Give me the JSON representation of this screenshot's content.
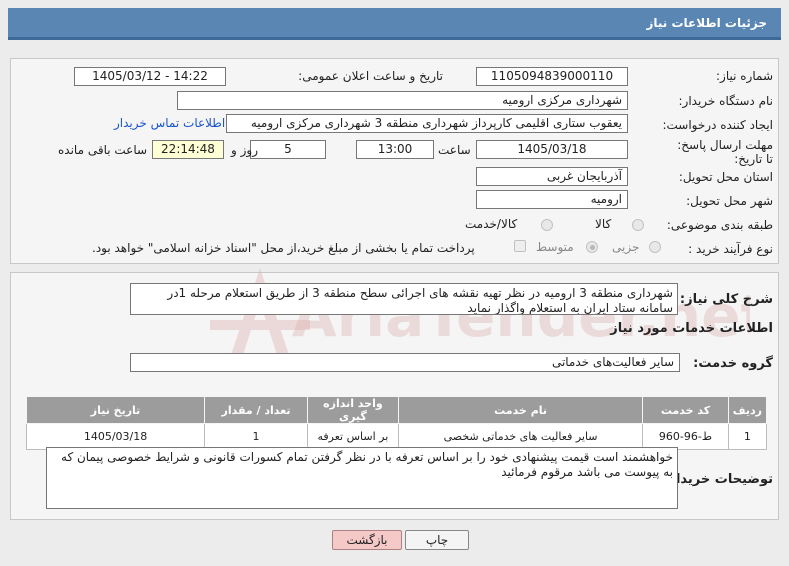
{
  "header": {
    "title": "جزئیات اطلاعات نیاز"
  },
  "form": {
    "need_number_label": "شماره نیاز:",
    "need_number": "1105094839000110",
    "announce_label": "تاریخ و ساعت اعلان عمومی:",
    "announce_value": "1405/03/12 - 14:22",
    "buyer_org_label": "نام دستگاه خریدار:",
    "buyer_org": "شهرداری مرکزی ارومیه",
    "creator_label": "ایجاد کننده درخواست:",
    "creator": "یعقوب ستاری اقلیمی کارپرداز شهرداری منطقه 3 شهرداری مرکزی ارومیه",
    "contact_link": "اطلاعات تماس خریدار",
    "deadline_label": "مهلت ارسال پاسخ: تا تاریخ:",
    "deadline_date": "1405/03/18",
    "time_label": "ساعت",
    "deadline_time": "13:00",
    "days_value": "5",
    "days_label": "روز و",
    "remaining_time": "22:14:48",
    "remaining_label": "ساعت باقی مانده",
    "province_label": "استان محل تحویل:",
    "province": "آذربایجان غربی",
    "city_label": "شهر محل تحویل:",
    "city": "ارومیه",
    "category_label": "طبقه بندی موضوعی:",
    "category_options": [
      "کالا",
      "کالا/خدمت"
    ],
    "process_label": "نوع فرآیند خرید :",
    "process_options": [
      "جزیی",
      "متوسط"
    ],
    "payment_note": "پرداخت تمام یا بخشی از مبلغ خرید،از محل \"اسناد خزانه اسلامی\" خواهد بود."
  },
  "description": {
    "label": "شرح کلی نیاز:",
    "text": "شهرداری منطقه 3 ارومیه در نظر تهیه نقشه های اجرائی سطح منطقه 3 از طریق استعلام مرحله 1در سامانه ستاد ایران به استعلام واگذار نماید"
  },
  "services": {
    "section_title": "اطلاعات خدمات مورد نیاز",
    "group_label": "گروه خدمت:",
    "group_value": "سایر فعالیت‌های خدماتی",
    "columns": [
      "ردیف",
      "کد خدمت",
      "نام خدمت",
      "واحد اندازه گیری",
      "تعداد / مقدار",
      "تاریخ نیاز"
    ],
    "rows": [
      [
        "1",
        "ط-96-960",
        "سایر فعالیت های خدماتی شخصی",
        "بر اساس تعرفه",
        "1",
        "1405/03/18"
      ]
    ]
  },
  "buyer_notes": {
    "label": "توضیحات خریدار:",
    "text": "خواهشمند است قیمت پیشنهادی خود را بر اساس تعرفه با در نظر گرفتن تمام کسورات قانونی و شرایط خصوصی پیمان که به پیوست می باشد مرقوم فرمائید"
  },
  "buttons": {
    "print": "چاپ",
    "back": "بازگشت"
  },
  "watermark": {
    "text": "AriaTender.net"
  },
  "colors": {
    "header": "#5a86b4",
    "back_button": "#f6c9c9",
    "table_header": "#9c9c9c",
    "watermark": "#d9a8a8",
    "link": "#1a55cc"
  }
}
